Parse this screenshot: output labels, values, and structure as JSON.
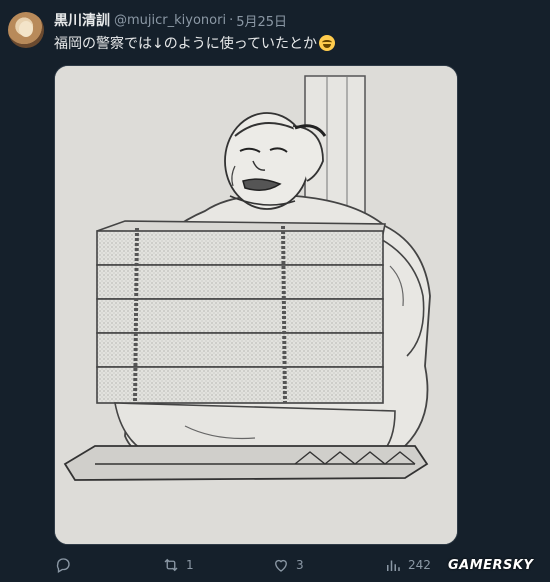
{
  "post": {
    "author_name": "黒川清訓",
    "handle": "@mujicr_kiyonori",
    "separator": "·",
    "date": "5月25日",
    "text": "福岡の警察では↓のように使っていたとか",
    "emoji": "grinning-squinting-face-emoji"
  },
  "media": {
    "icon": "illustration-image"
  },
  "actions": {
    "reply": {
      "icon": "reply-icon",
      "count": ""
    },
    "retweet": {
      "icon": "retweet-icon",
      "count": "1"
    },
    "like": {
      "icon": "heart-icon",
      "count": "3"
    },
    "views": {
      "icon": "views-icon",
      "count": "242"
    },
    "share": {
      "icon": "share-icon",
      "count": ""
    }
  },
  "watermark": {
    "text": "GAMERSKY"
  },
  "colors": {
    "background": "#15202b",
    "text_primary": "#e7e9ea",
    "text_secondary": "#8b98a5",
    "emoji": "#ffcc4d"
  }
}
